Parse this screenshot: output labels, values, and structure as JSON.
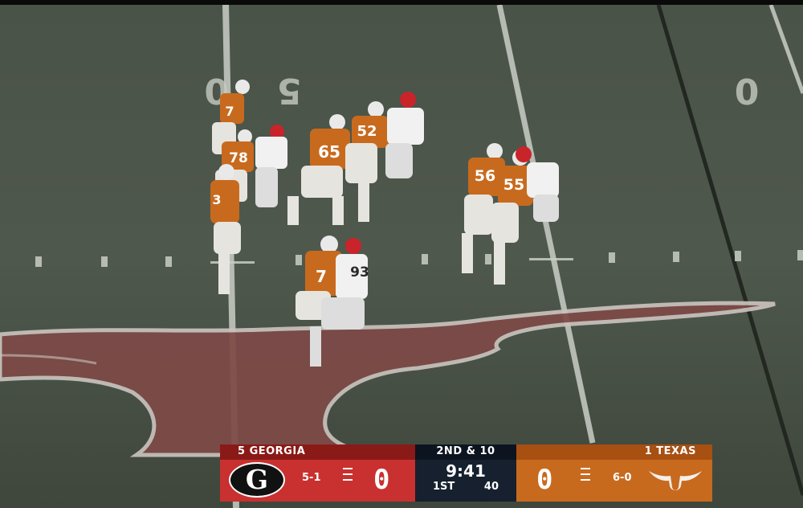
{
  "field": {
    "yard_number_left": "50",
    "yard_number_right": "0"
  },
  "scorebug": {
    "away": {
      "rank_name": "5 GEORGIA",
      "logo_letter": "G",
      "record": "5-1",
      "score": "0",
      "timeouts_remaining": 3,
      "color": "#c8312f"
    },
    "home": {
      "rank_name": "1 TEXAS",
      "record": "6-0",
      "score": "0",
      "timeouts_remaining": 3,
      "color": "#c86a1e",
      "logo_icon": "longhorn-icon"
    },
    "down_distance": "2ND & 10",
    "game_clock": "9:41",
    "quarter": "1ST",
    "play_clock": "40"
  },
  "players": [
    {
      "team": "texas",
      "number": "7"
    },
    {
      "team": "texas",
      "number": "78"
    },
    {
      "team": "texas",
      "number": "65"
    },
    {
      "team": "texas",
      "number": "52"
    },
    {
      "team": "texas",
      "number": "56"
    },
    {
      "team": "texas",
      "number": "55"
    },
    {
      "team": "texas",
      "number": "3"
    },
    {
      "team": "texas",
      "number": "7"
    },
    {
      "team": "georgia",
      "number": "93"
    }
  ]
}
